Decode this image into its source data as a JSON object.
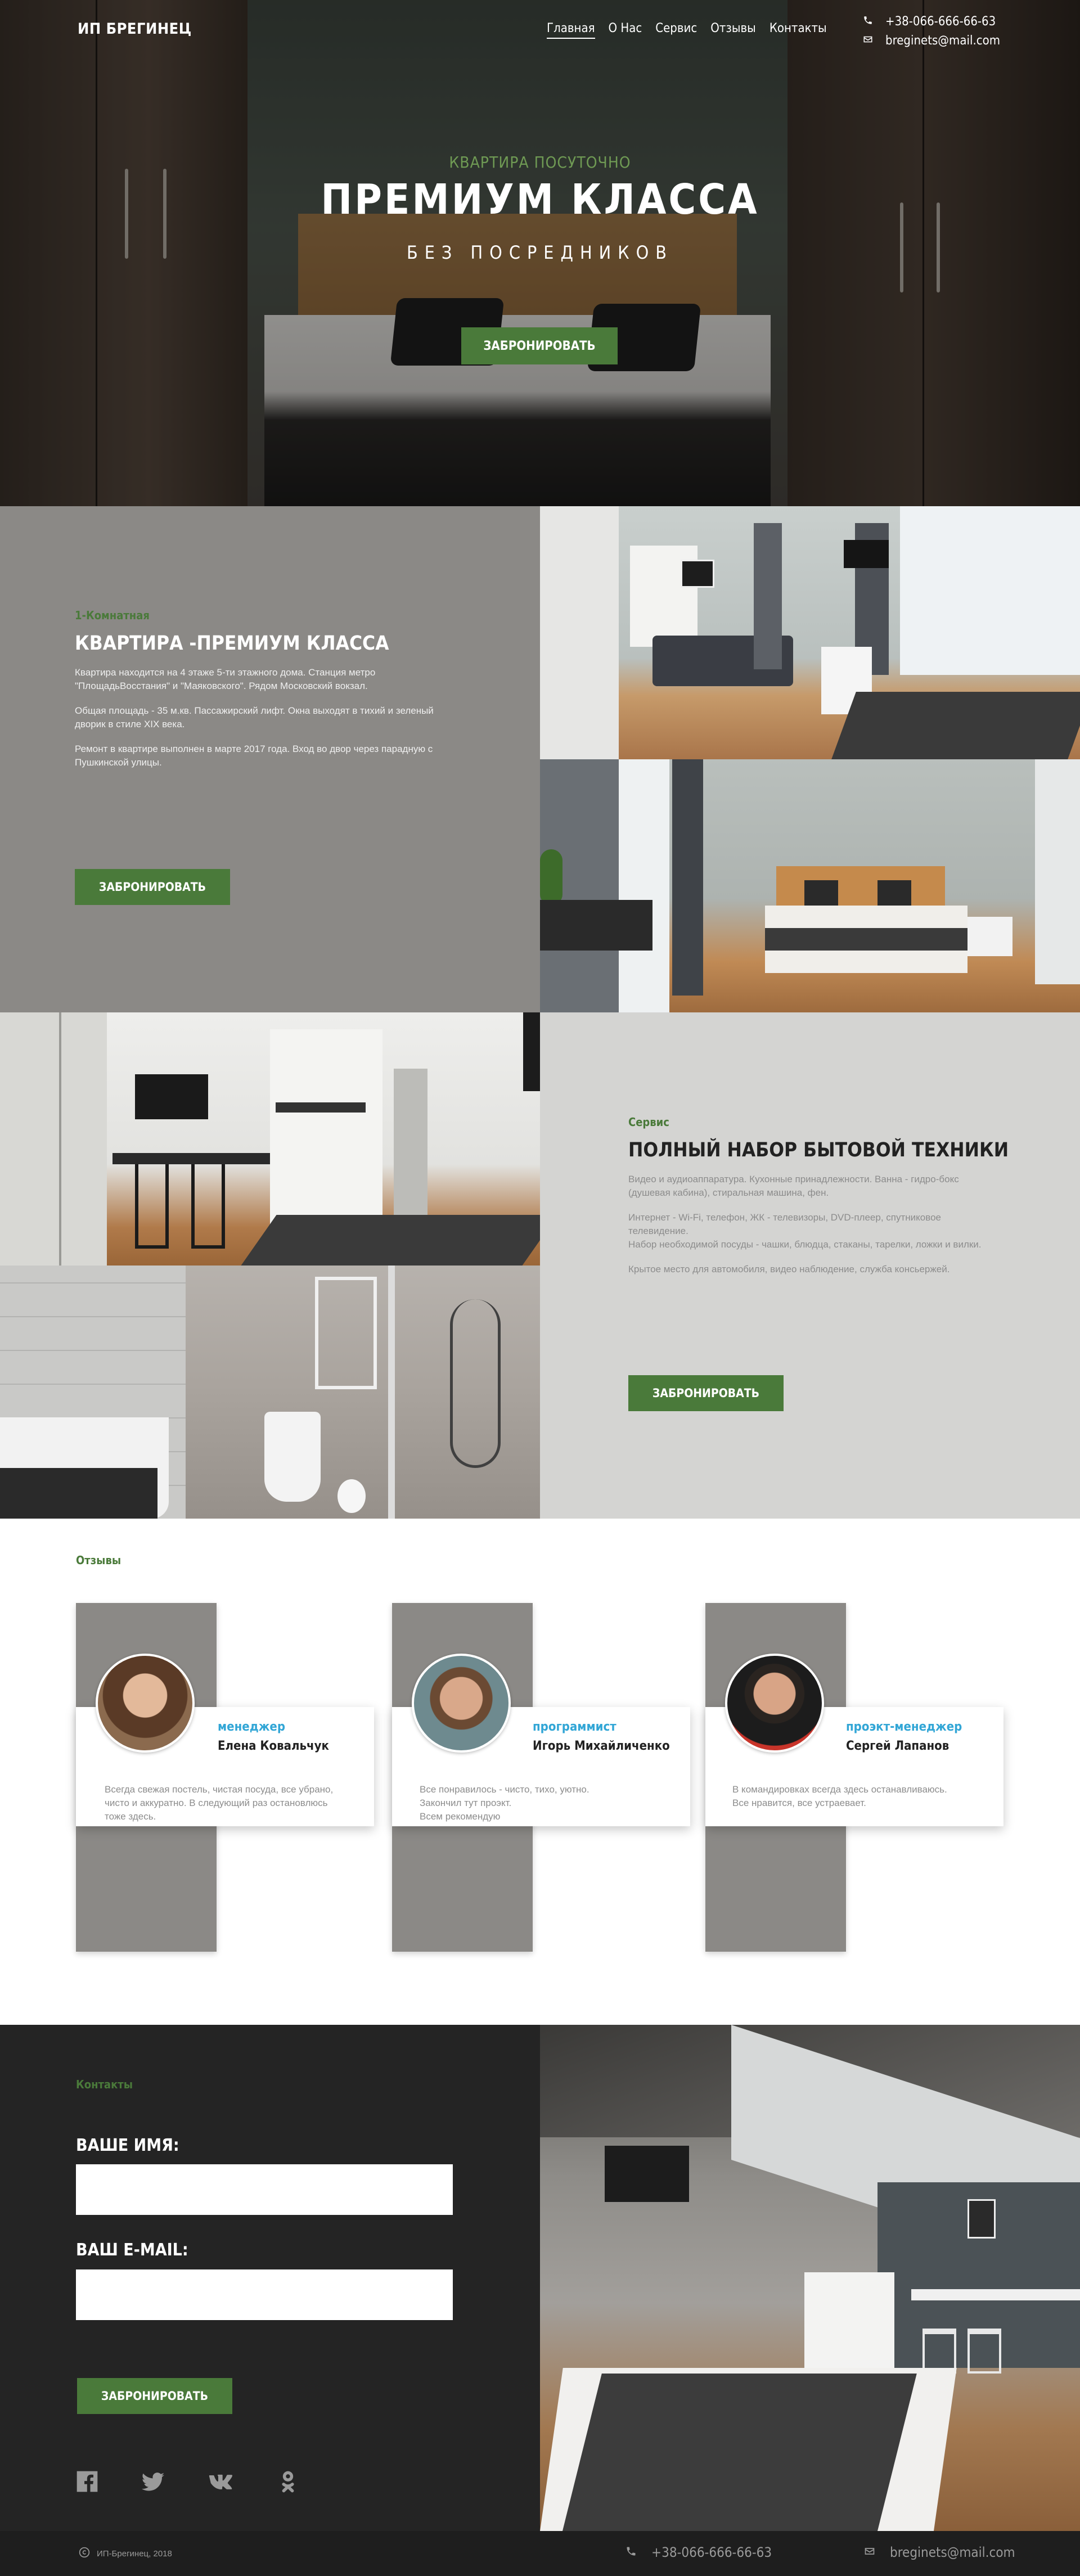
{
  "brand": "ИП БРЕГИНЕЦ",
  "nav": {
    "items": [
      "Главная",
      "О Нас",
      "Сервис",
      "Отзывы",
      "Контакты"
    ],
    "phone": "+38-066-666-66-63",
    "email": "breginets@mail.com"
  },
  "hero": {
    "kicker": "КВАРТИРА ПОСУТОЧНО",
    "title": "ПРЕМИУМ КЛАССА",
    "subtitle": "БЕЗ ПОСРЕДНИКОВ",
    "button": "ЗАБРОНИРОВАТЬ"
  },
  "apartment": {
    "kicker": "1-Комнатная",
    "title": "КВАРТИРА -ПРЕМИУМ КЛАССА",
    "p1": "Квартира находится на 4 этаже 5-ти этажного дома. Станция метро \"ПлощадьВосстания\" и \"Маяковского\". Рядом Московский вокзал.",
    "p2": "Общая площадь - 35 м.кв. Пассажирский лифт. Окна выходят в тихий и зеленый дворик в стиле XIX века.",
    "p3": "Ремонт в квартире выполнен в марте 2017 года. Вход во двор через парадную с Пушкинской улицы.",
    "button": "ЗАБРОНИРОВАТЬ"
  },
  "service": {
    "kicker": "Сервис",
    "title": "ПОЛНЫЙ НАБОР БЫТОВОЙ ТЕХНИКИ",
    "p1": "Видео и аудиоаппаратура. Кухонные принадлежности. Ванна - гидро-бокс (душевая кабина), стиральная машина, фен.",
    "p2": "Интернет - Wi-Fi, телефон, ЖК - телевизоры, DVD-плеер, спутниковое телевидение.",
    "p3": "Набор необходимой посуды - чашки, блюдца, стаканы, тарелки, ложки и вилки.",
    "p4": "Крытое место для автомобиля, видео наблюдение, служба консьержей.",
    "button": "ЗАБРОНИРОВАТЬ"
  },
  "reviews": {
    "kicker": "Отзывы",
    "items": [
      {
        "role": "менеджер",
        "name": "Елена Ковальчук",
        "text": "Всегда свежая постель, чистая посуда, все убрано, чисто и аккуратно. В следующий раз остановлюсь тоже здесь."
      },
      {
        "role": "программист",
        "name": "Игорь Михайличенко",
        "text": "Все понравилось - чисто, тихо, уютно.\nЗакончил тут проэкт.\nВсем рекомендую"
      },
      {
        "role": "проэкт-менеджер",
        "name": "Сергей Лапанов",
        "text": "В командировках всегда здесь останавливаюсь.\nВсе нравится, все устраевает."
      }
    ]
  },
  "contacts": {
    "kicker": "Контакты",
    "name_label": "ВАШЕ ИМЯ:",
    "email_label": "ВАШ E-MAIL:",
    "button": "ЗАБРОНИРОВАТЬ",
    "socials": [
      "facebook-icon",
      "twitter-icon",
      "vk-icon",
      "odnoklassniki-icon"
    ]
  },
  "footer": {
    "copyright": "ИП-Брегинец, 2018",
    "phone": "+38-066-666-66-63",
    "email": "breginets@mail.com"
  },
  "colors": {
    "accent_green": "#4a7a3a",
    "role_blue": "#32a6d6",
    "gray_panel": "#8b8986",
    "light_panel": "#d4d4d2",
    "dark_panel": "#242424"
  }
}
